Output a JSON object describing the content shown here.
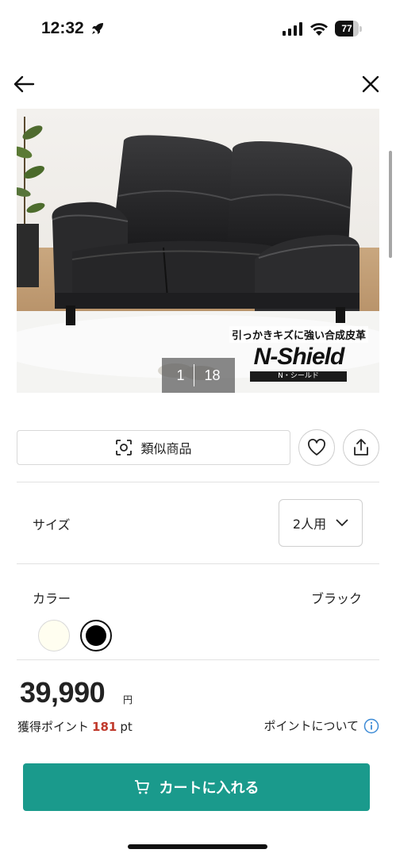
{
  "status": {
    "time": "12:32",
    "battery": "77",
    "battery_level": 0.77
  },
  "nav": {
    "back_icon": "arrow-left-icon",
    "close_icon": "close-icon"
  },
  "image": {
    "feature_caption": "引っかきキズに強い合成皮革",
    "brand_main": "N-Shield",
    "brand_sub": "N・シールド",
    "counter_current": "1",
    "counter_total": "18"
  },
  "actions": {
    "similar_label": "類似商品",
    "similar_icon": "scan-icon",
    "favorite_icon": "heart-icon",
    "share_icon": "share-icon"
  },
  "size": {
    "label": "サイズ",
    "selected": "2人用"
  },
  "color": {
    "label": "カラー",
    "selected": "ブラック",
    "swatches": [
      "#fffef0",
      "#000000"
    ]
  },
  "price": {
    "amount": "39,990",
    "unit": "円"
  },
  "points": {
    "label": "獲得ポイント",
    "value": "181",
    "unit": "pt",
    "info_label": "ポイントについて"
  },
  "cart": {
    "label": "カートに入れる",
    "color": "#1a9a8c"
  },
  "colors": {
    "accent": "#1a9a8c",
    "points": "#c0392b",
    "info": "#3d8bd6"
  }
}
